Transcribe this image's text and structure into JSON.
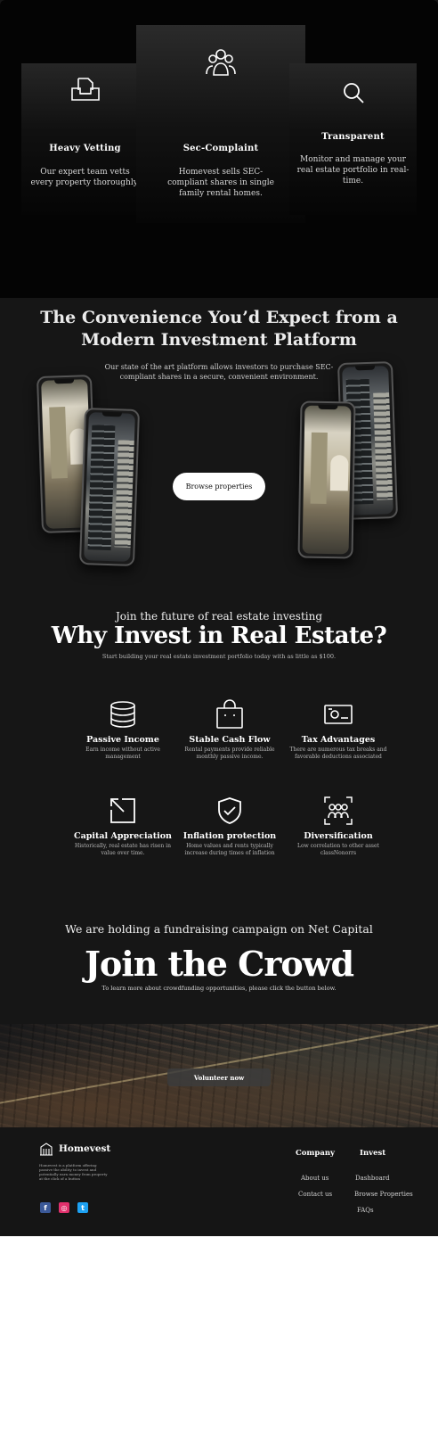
{
  "features": [
    {
      "title": "Heavy Vetting",
      "text": "Our expert team vetts every property thoroughly.",
      "icon": "document-tray-icon"
    },
    {
      "title": "Sec-Complaint",
      "text": "Homevest sells SEC-compliant shares in single family rental homes.",
      "icon": "users-icon"
    },
    {
      "title": "Transparent",
      "text": "Monitor and manage your real estate portfolio in real-time.",
      "icon": "search-icon"
    }
  ],
  "platform": {
    "title": "The Convenience You’d Expect from a Modern Investment Platform",
    "subtitle": "Our state of the art platform allows investors to purchase SEC-compliant shares in a secure, convenient environment.",
    "browse_label": "Browse properties"
  },
  "why": {
    "kicker": "Join the future of real estate investing",
    "title": "Why Invest in Real Estate?",
    "subtitle": "Start building your real estate investment portfolio today with as little as $100.",
    "benefits": [
      {
        "title": "Passive Income",
        "text": "Earn income without active management",
        "icon": "coins-icon"
      },
      {
        "title": "Stable Cash Flow",
        "text": "Rental payments provide reliable monthly passive income.",
        "icon": "shopping-bag-icon"
      },
      {
        "title": "Tax Advantages",
        "text": "There are numerous tax breaks and favorable deductions associated",
        "icon": "banknote-icon"
      },
      {
        "title": "Capital Appreciation",
        "text": "Historically, real estate has risen in value over time.",
        "icon": "arrow-up-left-icon"
      },
      {
        "title": "Inflation protection",
        "text": "Home values and rents typically increase during times of inflation",
        "icon": "shield-check-icon"
      },
      {
        "title": "Diversification",
        "text": "Low correlation to other asset classNonorrs",
        "icon": "group-focus-icon"
      }
    ]
  },
  "crowd": {
    "lead": "We are holding a fundraising campaign on Net Capital",
    "title": "Join the Crowd",
    "subtitle": "To learn more about crowdfunding opportunities, please click the button below.",
    "button": "Volunteer now"
  },
  "footer": {
    "brand": "Homevest",
    "description": "Homevest is a platform offering passive the ability to invest and potentially earn money from property at the click of a button",
    "company_title": "Company",
    "company_links": [
      "About us",
      "Contact us"
    ],
    "invest_title": "Invest",
    "invest_links": [
      "Dashboard",
      "Browse Properties",
      "FAQs"
    ],
    "socials": [
      {
        "name": "facebook-icon",
        "glyph": "f",
        "color": "#3b5998"
      },
      {
        "name": "instagram-icon",
        "glyph": "◎",
        "color": "#e1306c"
      },
      {
        "name": "twitter-icon",
        "glyph": "t",
        "color": "#1da1f2"
      }
    ]
  }
}
